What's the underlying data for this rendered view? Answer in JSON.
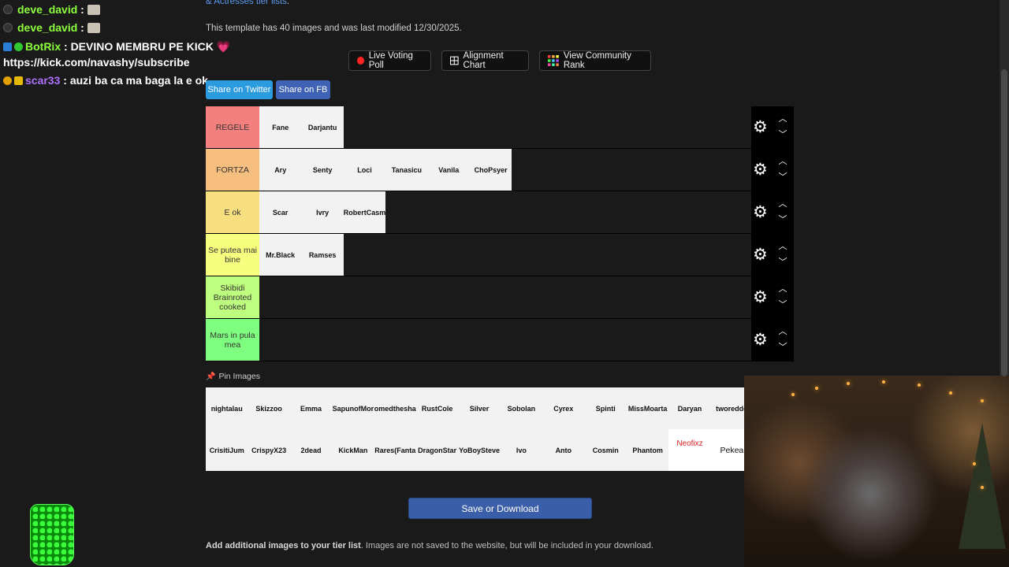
{
  "chat": [
    {
      "user": "deve_david",
      "msg": ":",
      "emote": true
    },
    {
      "user": "deve_david",
      "msg": ":",
      "emote": true
    },
    {
      "user": "BotRix",
      "msg": ": DEVINO MEMBRU PE KICK 💗"
    },
    {
      "user": "",
      "msg": "https://kick.com/navashy/subscribe"
    },
    {
      "user": "scar33",
      "msg": ": auzi ba ca ma baga la e ok"
    }
  ],
  "page": {
    "intro_link": "& Actresses tier lists",
    "intro_dot": ".",
    "meta": "This template has 40 images and was last modified 12/30/2025."
  },
  "buttons": {
    "live_voting": "Live Voting Poll",
    "alignment": "Alignment Chart",
    "community": "View Community Rank",
    "share_twitter": "Share on Twitter",
    "share_fb": "Share on FB",
    "save": "Save or Download"
  },
  "tiers": [
    {
      "label": "REGELE",
      "color": "#f47f7f",
      "items": [
        "Fane",
        "Darjantu"
      ]
    },
    {
      "label": "FORTZA",
      "color": "#f7bf7f",
      "items": [
        "Ary",
        "Senty",
        "Loci",
        "Tanasicu",
        "Vanila",
        "ChoPsyer"
      ]
    },
    {
      "label": "E ok",
      "color": "#f7df7f",
      "items": [
        "Scar",
        "Ivry",
        "RobertCasm"
      ]
    },
    {
      "label": "Se putea mai bine",
      "color": "#f7ff7f",
      "items": [
        "Mr.Black",
        "Ramses"
      ]
    },
    {
      "label": "Skibidi Brainroted cooked",
      "color": "#bfff7f",
      "items": []
    },
    {
      "label": "Mars in pula mea",
      "color": "#7fff7f",
      "items": []
    }
  ],
  "pin_images": "Pin Images",
  "pool": [
    "nightalau",
    "Skizzoo",
    "Emma",
    "SapunofMor",
    "omedthesha",
    "RustCole",
    "Silver",
    "Sobolan",
    "Cyrex",
    "Spinti",
    "MissMoarta",
    "Daryan",
    "tworeddo",
    "CrisitiJum",
    "CrispyX23",
    "2dead",
    "KickMan",
    "Rares(Fanta",
    "DragonStar",
    "YoBoySteve",
    "Ivo",
    "Anto",
    "Cosmin",
    "Phantom",
    "Neofixz",
    "Pekea"
  ],
  "add_text": {
    "bold": "Add additional images to your tier list",
    "rest": ". Images are not saved to the website, but will be included in your download."
  }
}
